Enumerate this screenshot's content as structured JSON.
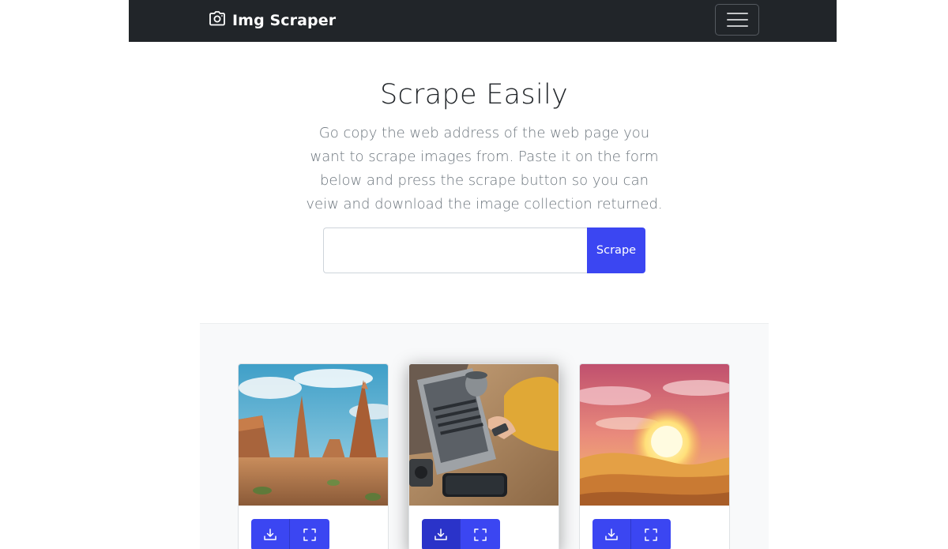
{
  "app": {
    "brand": "Img Scraper",
    "brand_icon": "camera-icon",
    "menu_icon": "hamburger-menu-icon"
  },
  "hero": {
    "title": "Scrape Easily",
    "description": "Go copy the web address of the web page you want to scrape images from. Paste it on the form below and press the scrape button so you can veiw and download the image collection returned."
  },
  "form": {
    "url_value": "",
    "url_placeholder": "",
    "submit_label": "Scrape"
  },
  "gallery": {
    "cards": [
      {
        "image": "desert-canyon-landscape",
        "download_icon": "download-icon",
        "expand_icon": "fullscreen-icon"
      },
      {
        "image": "laptop-desk-workspace",
        "download_icon": "download-icon",
        "expand_icon": "fullscreen-icon",
        "highlighted": true
      },
      {
        "image": "sunset-over-sand-dunes",
        "download_icon": "download-icon",
        "expand_icon": "fullscreen-icon"
      }
    ]
  },
  "colors": {
    "navbar": "#212529",
    "accent": "#3b46f2",
    "gallery_bg": "#f8f9fa",
    "muted_text": "#6c757d"
  }
}
